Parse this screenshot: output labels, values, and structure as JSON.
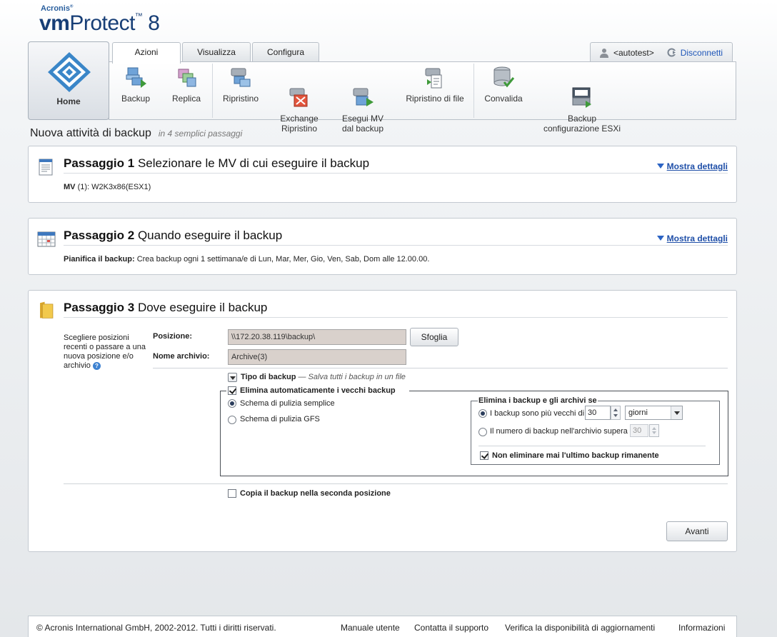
{
  "app": {
    "brand": "Acronis",
    "product_light": "vm",
    "product_bold": "Protect",
    "version": "8"
  },
  "tabs": [
    {
      "label": "Azioni"
    },
    {
      "label": "Visualizza"
    },
    {
      "label": "Configura"
    }
  ],
  "user": {
    "name": "<autotest>",
    "logout": "Disconnetti"
  },
  "home": {
    "label": "Home"
  },
  "ribbon": [
    {
      "label": "Backup"
    },
    {
      "label": "Replica"
    },
    {
      "label": "Ripristino"
    },
    {
      "label": "Exchange\nRipristino"
    },
    {
      "label": "Esegui MV\ndal backup"
    },
    {
      "label": "Ripristino di file"
    },
    {
      "label": "Convalida"
    },
    {
      "label": "Backup\nconfigurazione ESXi"
    }
  ],
  "page": {
    "title": "Nuova attività di backup",
    "subtitle": "in 4 semplici passaggi"
  },
  "show_details": "Mostra dettagli",
  "step1": {
    "num": "Passaggio 1",
    "title": "Selezionare le MV di cui eseguire il backup",
    "summary_label": "MV",
    "summary_count": "(1):",
    "summary_value": "W2K3x86(ESX1)"
  },
  "step2": {
    "num": "Passaggio 2",
    "title": "Quando eseguire il backup",
    "summary_label": "Pianifica il backup:",
    "summary_value": "Crea backup ogni 1 settimana/e di Lun, Mar, Mer, Gio, Ven, Sab, Dom alle 12.00.00."
  },
  "step3": {
    "num": "Passaggio 3",
    "title": "Dove eseguire il backup",
    "help_text": "Scegliere posizioni\nrecenti o passare a una\nnuova posizione e/o\narchivio",
    "location_label": "Posizione:",
    "location_value": "\\\\172.20.38.119\\backup\\",
    "browse": "Sfoglia",
    "archive_label": "Nome archivio:",
    "archive_value": "Archive(3)",
    "backup_type_label": "Tipo di backup",
    "backup_type_desc": "— Salva tutti i backup in un file",
    "auto_delete_label": "Elimina automaticamente i vecchi backup",
    "scheme_simple": "Schema di pulizia semplice",
    "scheme_gfs": "Schema di pulizia GFS",
    "delete_if_label": "Elimina i backup e gli archivi se",
    "older_than_label": "I backup sono più vecchi di",
    "older_than_value": "30",
    "unit_value": "giorni",
    "count_exceeds_label": "Il numero di backup nell'archivio supera",
    "count_value": "30",
    "never_delete_last": "Non eliminare mai l'ultimo backup rimanente",
    "copy_second": "Copia il backup nella seconda posizione",
    "next": "Avanti"
  },
  "footer": {
    "copyright": "© Acronis International GmbH, 2002-2012. Tutti i diritti riservati.",
    "links": [
      "Manuale utente",
      "Contatta il supporto",
      "Verifica la disponibilità di aggiornamenti",
      "Informazioni"
    ]
  }
}
